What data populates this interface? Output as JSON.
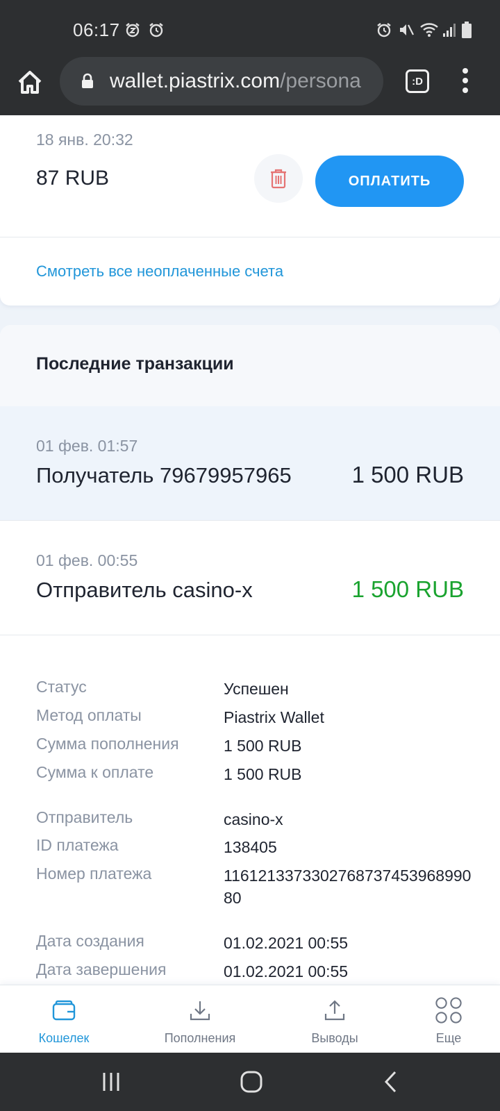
{
  "status_bar": {
    "time": "06:17",
    "left_icons": [
      "snooze-alarm-icon",
      "alarm-icon"
    ],
    "right_icons": [
      "alarm-icon",
      "mute-icon",
      "wifi-icon",
      "signal-icon",
      "battery-icon"
    ]
  },
  "browser": {
    "url_domain": "wallet.piastrix.com",
    "url_path": "/persona",
    "tabs_label": ":D"
  },
  "invoice": {
    "date": "18 янв. 20:32",
    "amount": "87 RUB",
    "pay_label": "ОПЛАТИТЬ",
    "view_all_label": "Смотреть все неоплаченные счета"
  },
  "transactions": {
    "title": "Последние транзакции",
    "items": [
      {
        "date": "01 фев. 01:57",
        "name": "Получатель 79679957965",
        "amount": "1 500 RUB",
        "color": "#1f2430"
      },
      {
        "date": "01 фев. 00:55",
        "name": "Отправитель casino-x",
        "amount": "1 500 RUB",
        "color": "#1aa32f"
      }
    ],
    "details": [
      {
        "label": "Статус",
        "value": "Успешен"
      },
      {
        "label": "Метод оплаты",
        "value": "Piastrix Wallet"
      },
      {
        "label": "Сумма пополнения",
        "value": "1 500 RUB"
      },
      {
        "label": "Сумма к оплате",
        "value": "1 500 RUB"
      },
      {
        "label": "Отправитель",
        "value": "casino-x"
      },
      {
        "label": "ID платежа",
        "value": "138405"
      },
      {
        "label": "Номер платежа",
        "value": "116121337330276873745396899080"
      },
      {
        "label": "Дата создания",
        "value": "01.02.2021 00:55"
      },
      {
        "label": "Дата завершения",
        "value": "01.02.2021 00:55"
      }
    ]
  },
  "bottom_nav": [
    {
      "label": "Кошелек",
      "icon": "wallet-icon",
      "active": true
    },
    {
      "label": "Пополнения",
      "icon": "download-icon",
      "active": false
    },
    {
      "label": "Выводы",
      "icon": "upload-icon",
      "active": false
    },
    {
      "label": "Еще",
      "icon": "more-circles-icon",
      "active": false
    }
  ],
  "colors": {
    "accent": "#2196f3",
    "link": "#2196d9",
    "positive": "#1aa32f",
    "muted": "#8a93a2"
  }
}
